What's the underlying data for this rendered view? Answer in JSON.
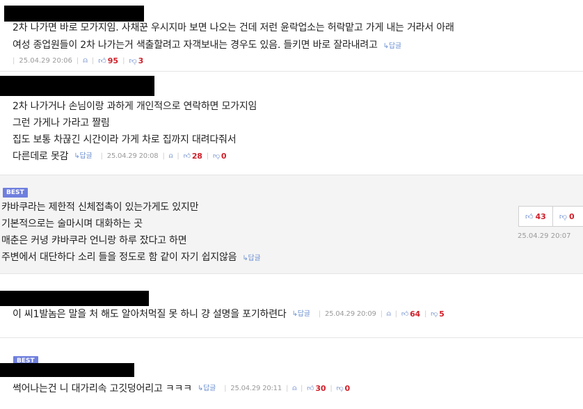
{
  "comments": [
    {
      "lines": [
        "2차 나가면 바로 모가지임. 사채꾼 우시지마 보면 나오는 건데 저런 윤락업소는 허락맡고 가게 내는 거라서 아래",
        "여성 종업원들이 2차 나가는거 색출할려고 자객보내는 경우도 있음. 들키면 바로 잘라내려고"
      ],
      "reply": "답글",
      "date": "25.04.29 20:06",
      "up": "95",
      "down": "3"
    },
    {
      "lines": [
        "2차 나가거나 손님이랑 과하게 개인적으로 연락하면 모가지임",
        "그런 가게나 가라고 짤림",
        "집도 보통 차끊긴 시간이라 가게 차로 집까지 대려다줘서",
        "다른데로 못감"
      ],
      "reply": "답글",
      "date": "25.04.29 20:08",
      "up": "28",
      "down": "0"
    },
    {
      "badge": "BEST",
      "lines": [
        "캬바쿠라는 제한적 신체접촉이 있는가게도 있지만",
        "기본적으로는 술마시며 대화하는 곳",
        "매춘은 커녕 캬바쿠라 언니랑 하루 잤다고 하면",
        "주변에서 대단하다 소리 들을 정도로 함 같이 자기 쉽지않음"
      ],
      "reply": "답글",
      "date": "25.04.29 20:07",
      "up": "43",
      "down": "0"
    },
    {
      "lines": [
        "이 씨1발놈은 말을 처 해도 알아처먹질 못 하니 걍 설명을 포기하련다"
      ],
      "reply": "답글",
      "date": "25.04.29 20:09",
      "up": "64",
      "down": "5"
    },
    {
      "badge": "BEST",
      "lines": [
        "썩어나는건 니 대가리속 고깃덩어리고 ㅋㅋㅋ"
      ],
      "reply": "답글",
      "date": "25.04.29 20:11",
      "up": "30",
      "down": "0"
    }
  ],
  "icons": {
    "reply": "reply-arrow-icon",
    "report": "siren-icon",
    "up": "thumbs-up-icon",
    "down": "thumbs-down-icon"
  },
  "colors": {
    "badge": "#6f7fde",
    "count": "#d0202a",
    "icon": "#5b7fc7",
    "best_bg": "#f4f4f4"
  }
}
